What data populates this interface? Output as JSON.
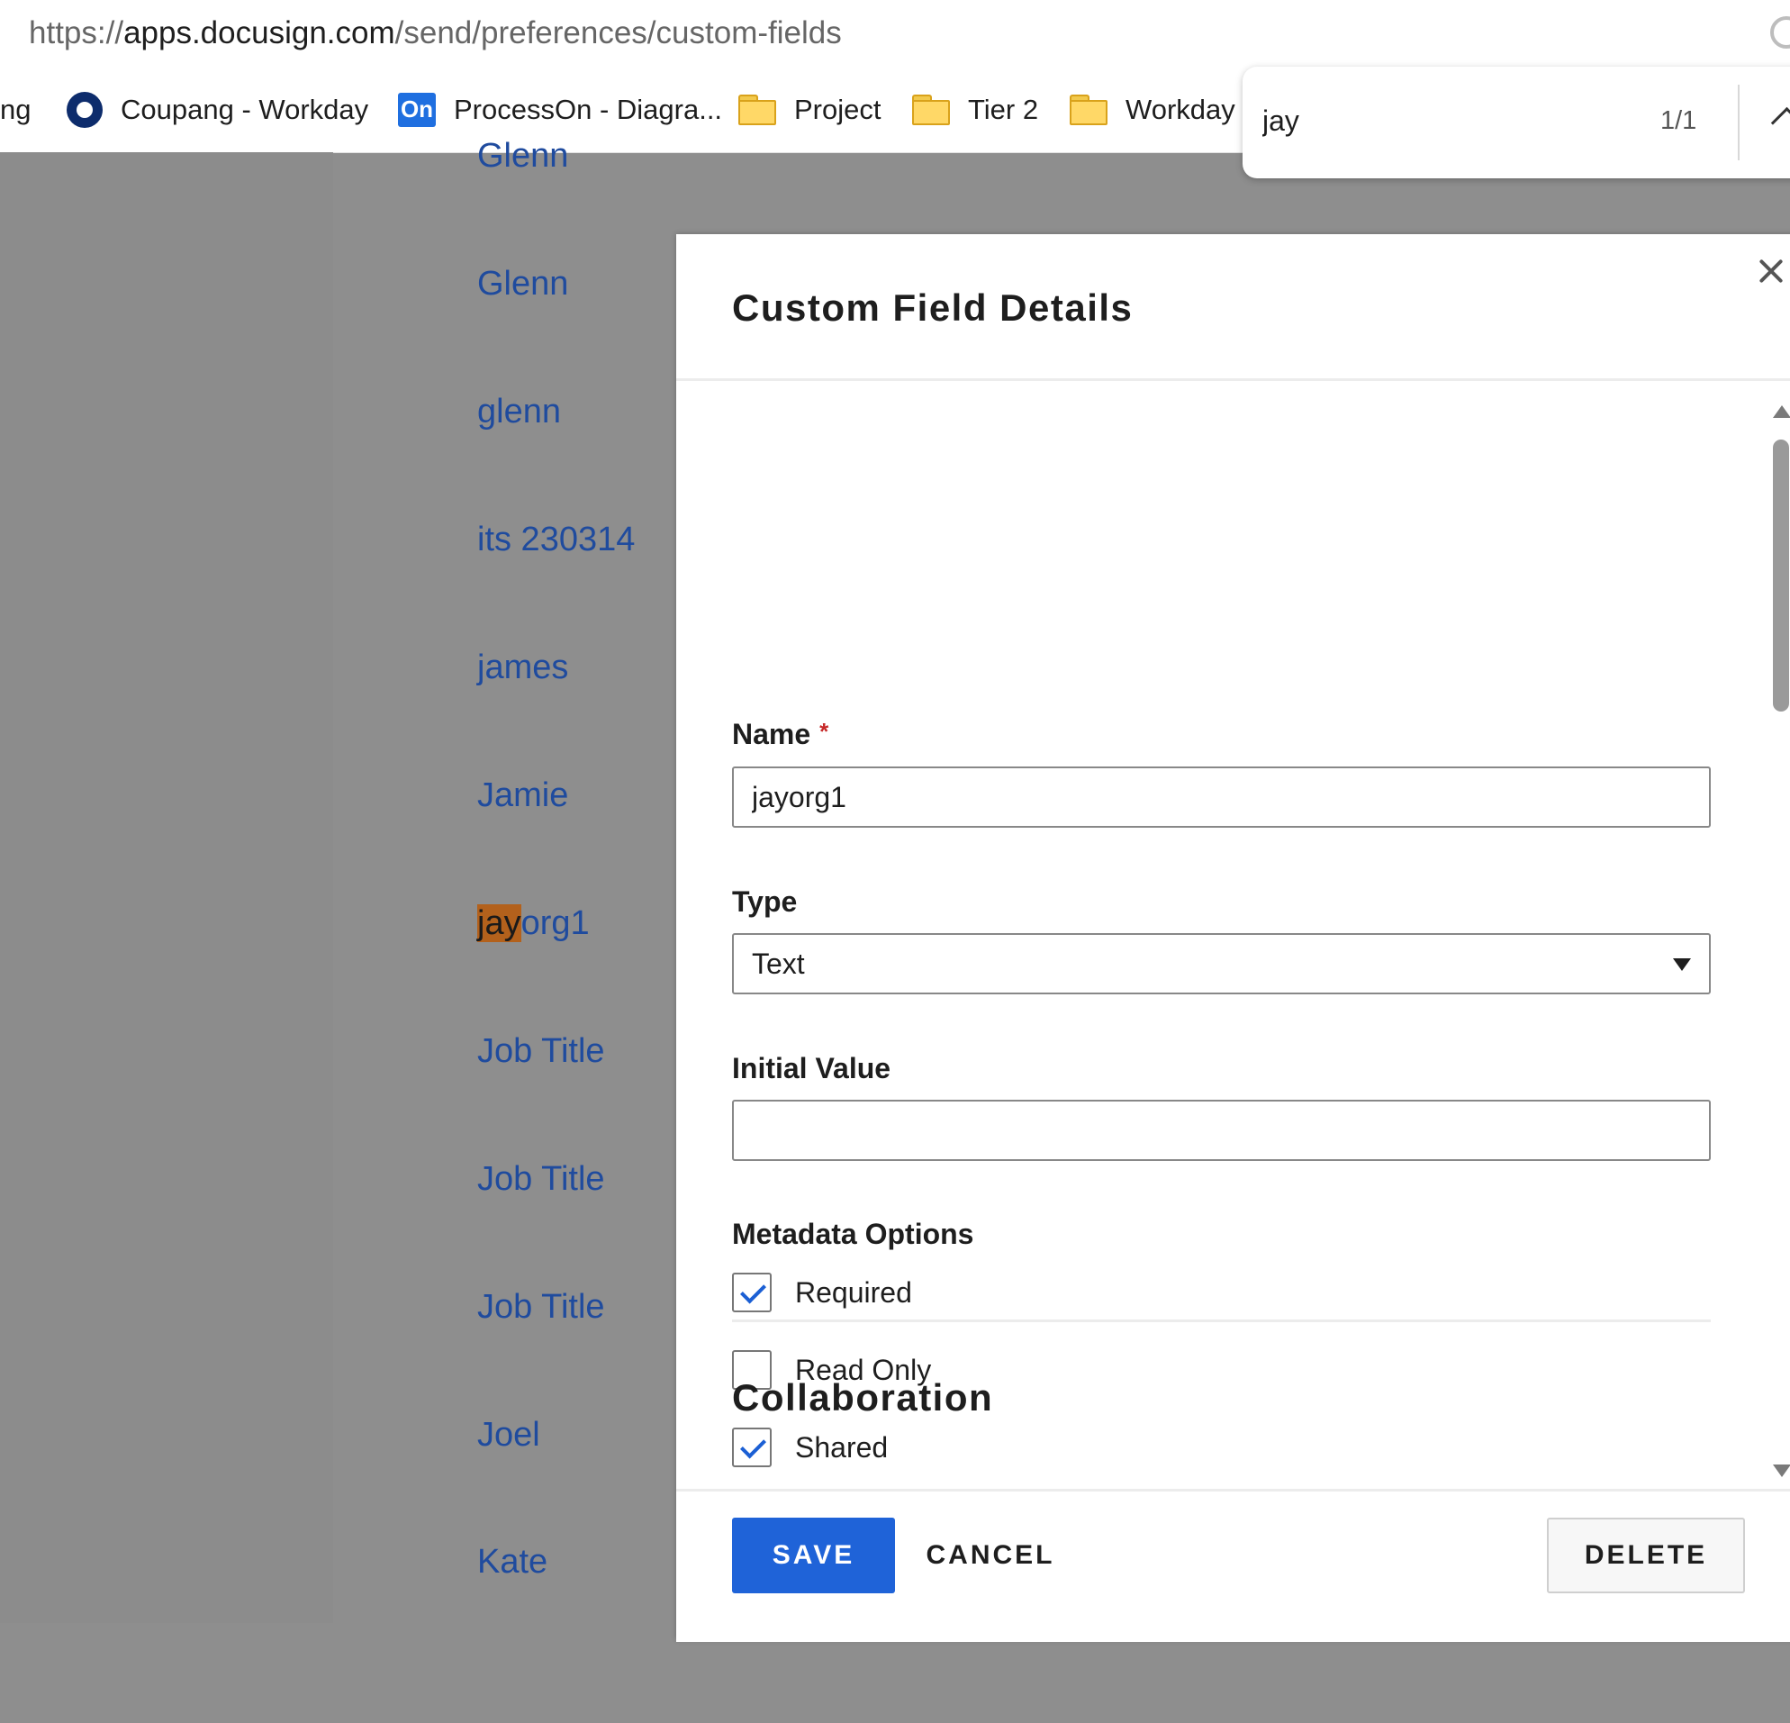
{
  "browser": {
    "url_prefix": "https://",
    "url_host": "apps.docusign.com",
    "url_path": "/send/preferences/custom-fields",
    "bookmarks": [
      {
        "label": "ng",
        "icon": "none"
      },
      {
        "label": "Coupang - Workday",
        "icon": "ring-logo-icon"
      },
      {
        "label": "ProcessOn - Diagra...",
        "icon": "processon-icon",
        "icon_text": "On"
      },
      {
        "label": "Project",
        "icon": "folder-icon"
      },
      {
        "label": "Tier 2",
        "icon": "folder-icon"
      },
      {
        "label": "Workday",
        "icon": "folder-icon"
      }
    ],
    "find": {
      "query": "jay",
      "count": "1/1"
    }
  },
  "background_list": {
    "items": [
      "Glenn",
      "Glenn",
      "glenn",
      "its 230314",
      "james",
      "Jamie",
      "jayorg1",
      "Job Title",
      "Job Title",
      "Job Title",
      "Joel",
      "Kate"
    ],
    "highlight": {
      "index": 6,
      "match": "jay",
      "rest": "org1"
    }
  },
  "modal": {
    "title": "Custom Field Details",
    "name_label": "Name",
    "required_mark": "*",
    "name_value": "jayorg1",
    "type_label": "Type",
    "type_value": "Text",
    "initial_value_label": "Initial Value",
    "initial_value": "",
    "metadata_label": "Metadata Options",
    "options": [
      {
        "label": "Required",
        "checked": true
      },
      {
        "label": "Read Only",
        "checked": false
      },
      {
        "label": "Shared",
        "checked": true
      }
    ],
    "collaboration_title": "Collaboration",
    "save_label": "SAVE",
    "cancel_label": "CANCEL",
    "delete_label": "DELETE"
  },
  "colors": {
    "primary_button": "#1f63d8",
    "link_text": "#1f4b9e",
    "find_highlight": "#b3611c",
    "overlay": "#8e8e8e"
  }
}
